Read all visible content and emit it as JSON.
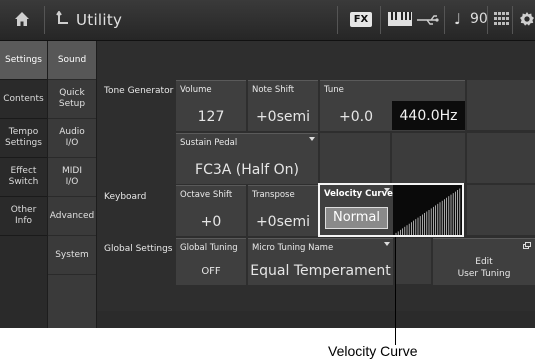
{
  "topbar": {
    "title": "Utility",
    "fx_label": "FX",
    "tempo": "90",
    "icons": [
      "home-icon",
      "utility-icon",
      "keyboard-icon",
      "usb-icon",
      "note-icon",
      "grid-icon",
      "gear-icon"
    ]
  },
  "left_tabs": [
    {
      "label": "Settings",
      "active": true
    },
    {
      "label": "Contents",
      "active": false
    },
    {
      "label": "Tempo\nSettings",
      "active": false
    },
    {
      "label": "Effect\nSwitch",
      "active": false
    },
    {
      "label": "Other\nInfo",
      "active": false
    }
  ],
  "sub_tabs": [
    {
      "label": "Sound",
      "active": true
    },
    {
      "label": "Quick\nSetup",
      "active": false
    },
    {
      "label": "Audio\nI/O",
      "active": false
    },
    {
      "label": "MIDI\nI/O",
      "active": false
    },
    {
      "label": "Advanced",
      "active": false
    },
    {
      "label": "System",
      "active": false
    }
  ],
  "sections": {
    "tone_generator": "Tone Generator",
    "keyboard": "Keyboard",
    "global_settings": "Global Settings"
  },
  "params": {
    "volume": {
      "label": "Volume",
      "value": "127"
    },
    "note_shift": {
      "label": "Note Shift",
      "value": "+0semi"
    },
    "tune": {
      "label": "Tune",
      "value": "+0.0",
      "hz": "440.0Hz"
    },
    "sustain_pedal": {
      "label": "Sustain Pedal",
      "value": "FC3A (Half On)"
    },
    "octave_shift": {
      "label": "Octave Shift",
      "value": "+0"
    },
    "transpose": {
      "label": "Transpose",
      "value": "+0semi"
    },
    "velocity_curve": {
      "label": "Velocity Curve",
      "value": "Normal"
    },
    "global_tuning": {
      "label": "Global Tuning",
      "value": "OFF"
    },
    "micro_tuning_name": {
      "label": "Micro Tuning Name",
      "value": "Equal Temperament"
    },
    "edit_user_tuning": {
      "label": "Edit\nUser Tuning"
    }
  },
  "callout": "Velocity Curve",
  "colors": {
    "screen_bg": "#1d1d1d",
    "cell_bg": "#3f3f3f",
    "active_tab": "#5a5a5a",
    "highlight_border": "#f4f4f4"
  }
}
